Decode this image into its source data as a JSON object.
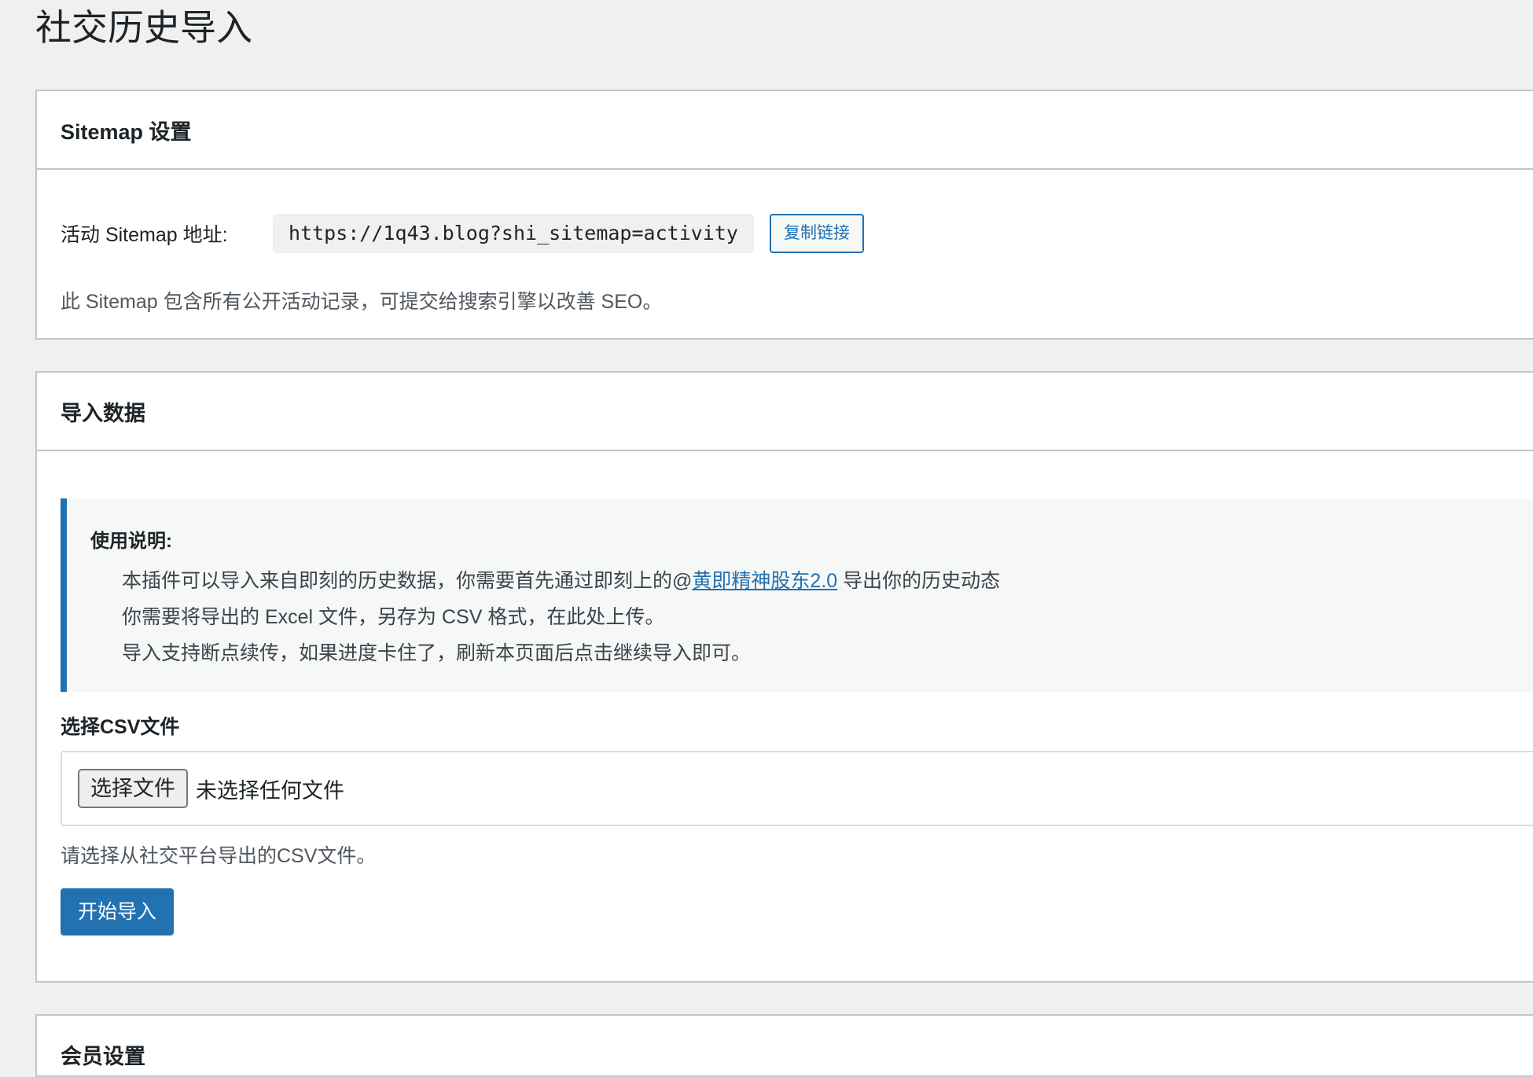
{
  "page": {
    "title": "社交历史导入"
  },
  "sitemap": {
    "heading": "Sitemap 设置",
    "label": "活动 Sitemap 地址:",
    "url": "https://1q43.blog?shi_sitemap=activity",
    "copy_label": "复制链接",
    "description": "此 Sitemap 包含所有公开活动记录，可提交给搜索引擎以改善 SEO。"
  },
  "import": {
    "heading": "导入数据",
    "notice_title": "使用说明:",
    "notice_line1_before": "本插件可以导入来自即刻的历史数据，你需要首先通过即刻上的@",
    "notice_link": "黄即精神股东2.0",
    "notice_line1_after": " 导出你的历史动态",
    "notice_line2": "你需要将导出的 Excel 文件，另存为 CSV 格式，在此处上传。",
    "notice_line3": "导入支持断点续传，如果进度卡住了，刷新本页面后点击继续导入即可。",
    "file_label": "选择CSV文件",
    "file_button": "选择文件",
    "file_status": "未选择任何文件",
    "help_text": "请选择从社交平台导出的CSV文件。",
    "start_button": "开始导入"
  },
  "more": {
    "heading": "会员设置"
  },
  "colors": {
    "accent": "#2271b1",
    "background": "#f0f0f1",
    "card": "#ffffff",
    "border": "#c3c4c7"
  }
}
